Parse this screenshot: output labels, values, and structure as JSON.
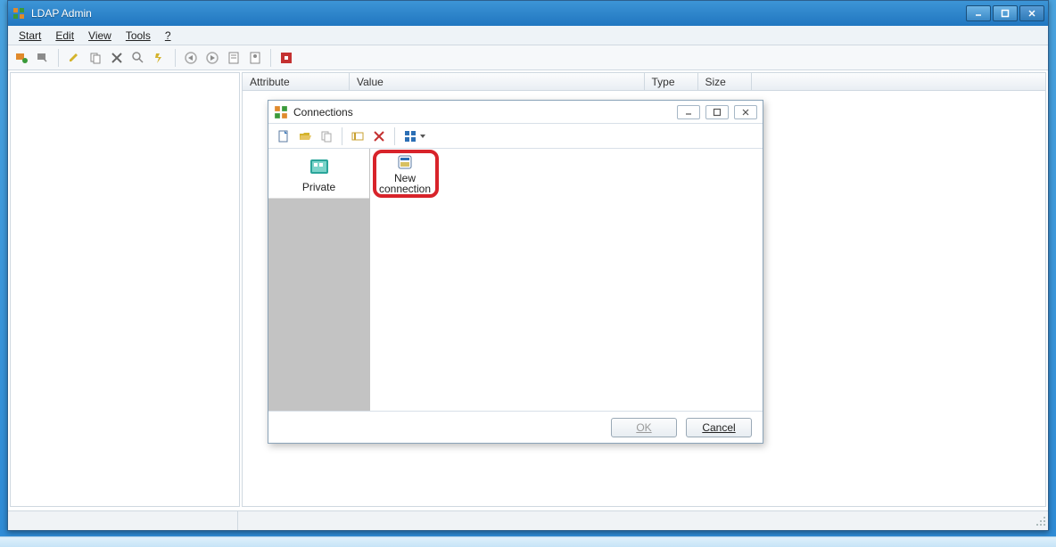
{
  "window": {
    "title": "LDAP Admin"
  },
  "menu": {
    "start": "Start",
    "edit": "Edit",
    "view": "View",
    "tools": "Tools",
    "help": "?"
  },
  "columns": {
    "attribute": "Attribute",
    "value": "Value",
    "type": "Type",
    "size": "Size"
  },
  "dialog": {
    "title": "Connections",
    "side": {
      "private": "Private"
    },
    "items": {
      "new_connection": "New\nconnection"
    },
    "buttons": {
      "ok": "OK",
      "cancel": "Cancel"
    }
  }
}
